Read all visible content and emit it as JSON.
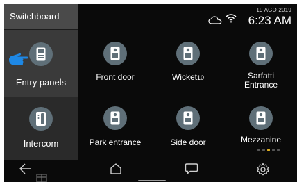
{
  "sidebar": {
    "title": "Switchboard",
    "items": [
      {
        "label": "Entry panels",
        "icon": "entry-panel-icon",
        "selected": true
      },
      {
        "label": "Intercom",
        "icon": "intercom-handset-icon",
        "selected": false
      }
    ]
  },
  "status": {
    "date": "19 AGO 2019",
    "time": "6:23 AM",
    "icons": [
      "cloud-icon",
      "wifi-icon"
    ]
  },
  "tiles": [
    {
      "label": "Front door",
      "icon": "door-panel-icon"
    },
    {
      "label": "Wicket",
      "suffix": "10",
      "icon": "door-panel-icon"
    },
    {
      "label": "Sarfatti Entrance",
      "icon": "door-panel-icon"
    },
    {
      "label": "Park entrance",
      "icon": "door-panel-icon"
    },
    {
      "label": "Side door",
      "icon": "door-panel-icon"
    },
    {
      "label": "Mezzanine",
      "icon": "door-panel-icon"
    }
  ],
  "pagination": {
    "pages": 5,
    "current": 3
  },
  "nav": {
    "buttons": [
      "back-arrow-icon",
      "home-icon",
      "chat-icon",
      "settings-gear-icon"
    ]
  },
  "colors": {
    "background": "#0a0a0a",
    "sidebar_selected": "#3a3a3a",
    "icon_circle": "#5f6f78",
    "hand_pointer": "#1e88e5",
    "pager_active": "#e0b020"
  }
}
